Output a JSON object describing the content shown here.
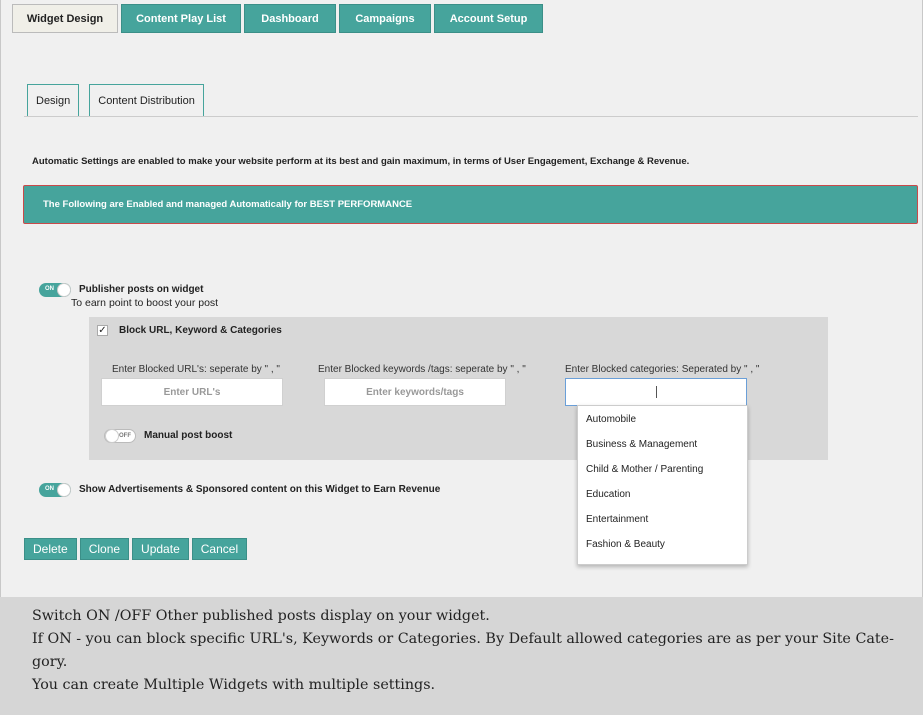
{
  "top_tabs": [
    {
      "label": "Widget Design"
    },
    {
      "label": "Content Play List"
    },
    {
      "label": "Dashboard"
    },
    {
      "label": "Campaigns"
    },
    {
      "label": "Account Setup"
    }
  ],
  "sub_tabs": [
    {
      "label": "Design"
    },
    {
      "label": "Content Distribution"
    }
  ],
  "intro_text": "Automatic Settings are enabled to make your website perform at its best and gain maximum, in terms of User Engagement, Exchange & Revenue.",
  "banner_text": "The Following are Enabled and managed Automatically for BEST PERFORMANCE",
  "publisher_toggle": {
    "state": "ON",
    "label": "Publisher posts on widget",
    "sub": "To earn point to boost your post"
  },
  "block_section": {
    "checkbox_label": "Block URL, Keyword & Categories",
    "checkbox_mark": "✓",
    "url_field": {
      "label": "Enter Blocked URL's: seperate by \" , \"",
      "placeholder": "Enter URL's"
    },
    "keyword_field": {
      "label": "Enter Blocked keywords /tags: seperate by \" , \"",
      "placeholder": "Enter keywords/tags"
    },
    "category_field": {
      "label": "Enter Blocked categories: Seperated by \" , \""
    },
    "manual_toggle": {
      "state": "OFF",
      "label": "Manual post boost"
    }
  },
  "category_dropdown": [
    "Automobile",
    "Business & Management",
    "Child & Mother / Parenting",
    "Education",
    "Entertainment",
    "Fashion & Beauty"
  ],
  "ads_toggle": {
    "state": "ON",
    "label": "Show Advertisements & Sponsored content on this Widget to Earn Revenue"
  },
  "buttons": {
    "delete": "Delete",
    "clone": "Clone",
    "update": "Update",
    "cancel": "Cancel"
  },
  "caption": {
    "line1": "Switch ON /OFF Other published posts display on your widget.",
    "line2": "If ON - you can block specific URL's, Keywords or Categories. By Default allowed categories are as per your Site Cate-",
    "line3": "gory.",
    "line4": "You can create Multiple Widgets with multiple settings."
  },
  "colors": {
    "accent": "#46a49c",
    "banner_border": "#c94a4a",
    "panel": "#d8d8d8"
  }
}
